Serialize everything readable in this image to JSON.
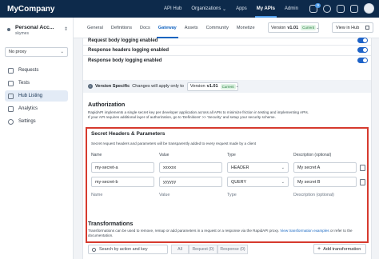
{
  "topbar": {
    "brand": "MyCompany",
    "nav": [
      "API Hub",
      "Organizations",
      "Apps",
      "My APIs",
      "Admin"
    ],
    "active_nav": "My APIs",
    "notification_count": "9"
  },
  "sidebar": {
    "account_name": "Personal Acc...",
    "account_user": "skymes",
    "proxy": "No proxy",
    "items": [
      "Requests",
      "Tests",
      "Hub Listing",
      "Analytics",
      "Settings"
    ],
    "active_item": "Hub Listing"
  },
  "subheader": {
    "tabs": [
      "General",
      "Definitions",
      "Docs",
      "Gateway",
      "Assets",
      "Community",
      "Monetize"
    ],
    "active_tab": "Gateway",
    "version_prefix": "Version",
    "version": "v1.01",
    "version_status": "Current",
    "view_in_hub": "View in Hub"
  },
  "content": {
    "toggle_rows": [
      "Request body logging enabled",
      "Response headers logging enabled",
      "Response body logging enabled"
    ],
    "version_specific_label": "Version Specific",
    "version_specific_text": "Changes will apply only to",
    "version_select": "v1.01",
    "authorization": {
      "title": "Authorization",
      "line1": "RapidAPI implements a single secret key per developer application across all APIs to minimize friction in testing and implementing APIs.",
      "line2": "If your API requires additional layer of authorization, go to 'Definitions' >> 'Security' and setup your security scheme."
    },
    "secret_headers": {
      "title": "Secret Headers & Parameters",
      "description": "Secret request headers and parameters will be transparently added to every request made by a client",
      "columns": [
        "Name",
        "Value",
        "Type",
        "Description (optional)"
      ],
      "rows": [
        {
          "name": "my-secret-a",
          "value": "xxxxxx",
          "type": "HEADER",
          "description": "My secret A"
        },
        {
          "name": "my-secret-b",
          "value": "yyyyyy",
          "type": "QUERY",
          "description": "My secret B"
        }
      ],
      "placeholders": {
        "name": "Name",
        "value": "Value",
        "type": "Type",
        "description": "Description (optional)"
      }
    },
    "transformations": {
      "title": "Transformations",
      "line1": "Transformations can be used to remove, remap or add parameters in a request or a response via the RapidAPI proxy.",
      "link": "View transformation examples",
      "line1_end": "or refer to the",
      "line2": "documentation.",
      "search_placeholder": "Search by action and key",
      "filters": [
        "All",
        "Request (0)",
        "Response (0)"
      ],
      "add_button": "Add transformation"
    }
  }
}
